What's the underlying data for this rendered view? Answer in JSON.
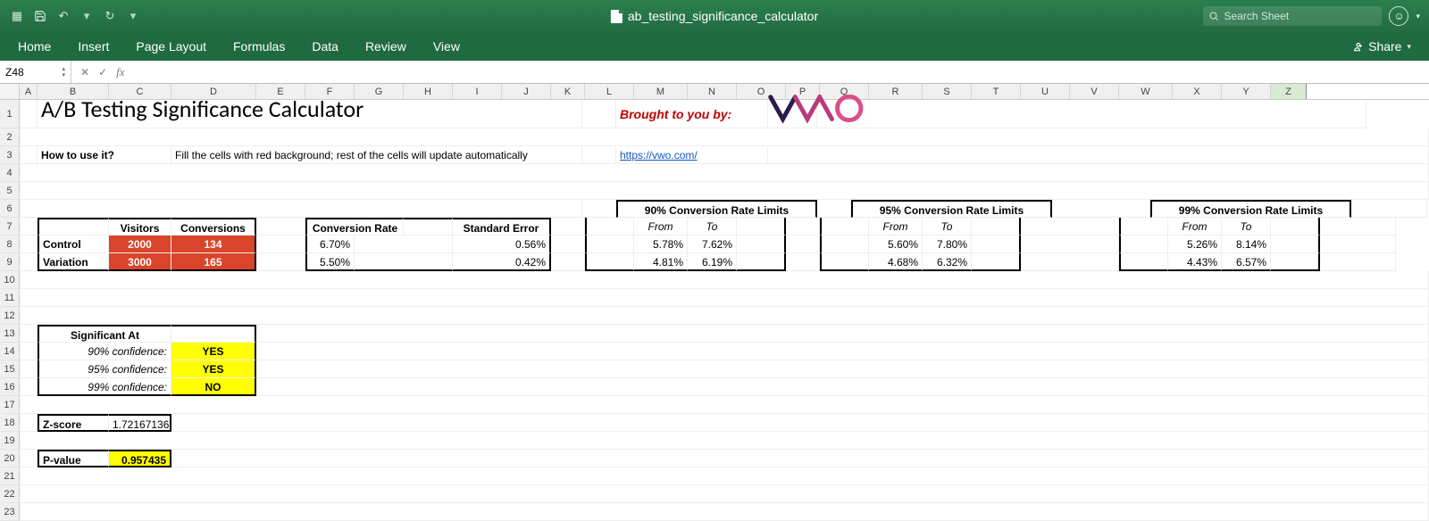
{
  "titlebar": {
    "document_name": "ab_testing_significance_calculator",
    "search_placeholder": "Search Sheet"
  },
  "ribbon": {
    "tabs": [
      "Home",
      "Insert",
      "Page Layout",
      "Formulas",
      "Data",
      "Review",
      "View"
    ],
    "share": "Share"
  },
  "formula_bar": {
    "name_box": "Z48",
    "fx_label": "fx"
  },
  "columns": [
    "A",
    "B",
    "C",
    "D",
    "E",
    "F",
    "G",
    "H",
    "I",
    "J",
    "K",
    "L",
    "M",
    "N",
    "O",
    "P",
    "Q",
    "R",
    "S",
    "T",
    "U",
    "V",
    "W",
    "X",
    "Y",
    "Z"
  ],
  "row_numbers": [
    "1",
    "2",
    "3",
    "4",
    "5",
    "6",
    "7",
    "8",
    "9",
    "10",
    "11",
    "12",
    "13",
    "14",
    "15",
    "16",
    "17",
    "18",
    "19",
    "20",
    "21",
    "22",
    "23"
  ],
  "content": {
    "title": "A/B Testing Significance Calculator",
    "brought": "Brought to you by:",
    "howto_label": "How to use it?",
    "howto_text": "Fill the cells with red background; rest of the cells will update automatically",
    "vwo_link": "https://vwo.com/",
    "hdr_visitors": "Visitors",
    "hdr_conversions": "Conversions",
    "hdr_conv_rate": "Conversion Rate",
    "hdr_std_err": "Standard Error",
    "limits90": "90% Conversion Rate Limits",
    "limits95": "95% Conversion Rate Limits",
    "limits99": "99% Conversion Rate Limits",
    "from": "From",
    "to": "To",
    "control": "Control",
    "variation": "Variation",
    "vis_ctrl": "2000",
    "vis_var": "3000",
    "conv_ctrl": "134",
    "conv_var": "165",
    "rate_ctrl": "6.70%",
    "rate_var": "5.50%",
    "se_ctrl": "0.56%",
    "se_var": "0.42%",
    "l90_cf": "5.78%",
    "l90_ct": "7.62%",
    "l90_vf": "4.81%",
    "l90_vt": "6.19%",
    "l95_cf": "5.60%",
    "l95_ct": "7.80%",
    "l95_vf": "4.68%",
    "l95_vt": "6.32%",
    "l99_cf": "5.26%",
    "l99_ct": "8.14%",
    "l99_vf": "4.43%",
    "l99_vt": "6.57%",
    "sig_at": "Significant At",
    "conf90": "90% confidence:",
    "conf95": "95% confidence:",
    "conf99": "99% confidence:",
    "sig90": "YES",
    "sig95": "YES",
    "sig99": "NO",
    "zscore_lbl": "Z-score",
    "zscore": "1.72167136",
    "pval_lbl": "P-value",
    "pval": "0.957435"
  }
}
